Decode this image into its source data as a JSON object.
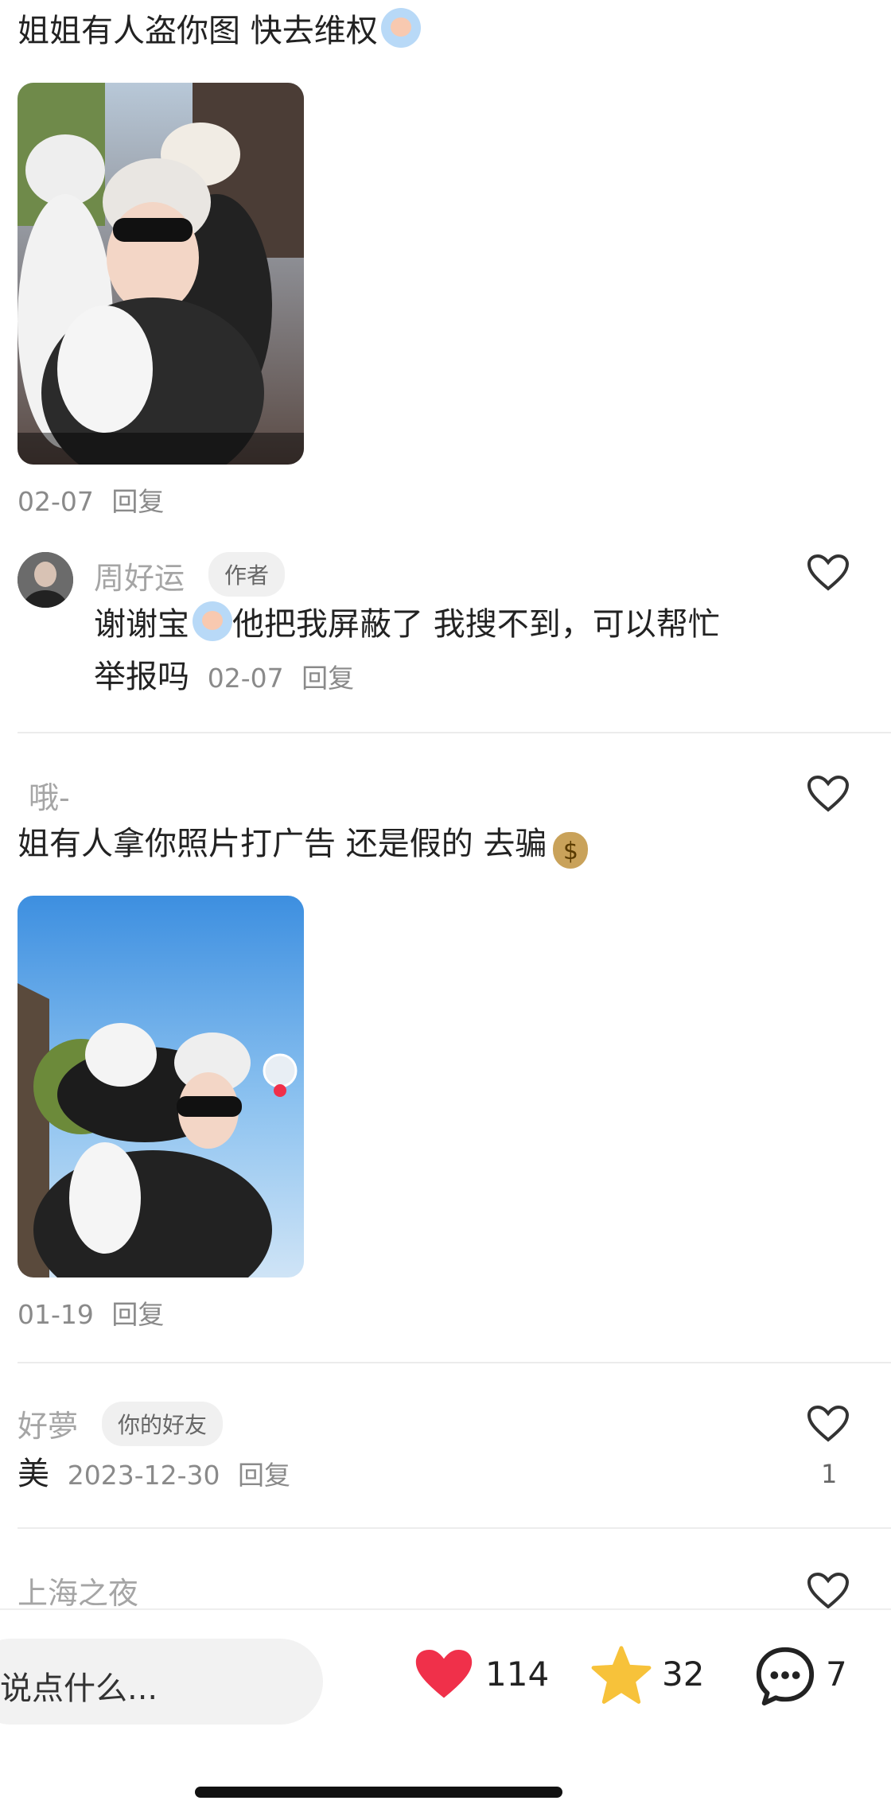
{
  "comments": [
    {
      "text": "姐姐有人盗你图 快去维权",
      "date": "02-07",
      "reply_label": "回复",
      "photo_alt": "截图"
    },
    {
      "name": "周好运",
      "badge": "作者",
      "text_line1": "谢谢宝",
      "text_line1b": "他把我屏蔽了 我搜不到，可以帮忙",
      "text_line2": "举报吗",
      "date": "02-07",
      "reply_label": "回复"
    },
    {
      "name": "哦-",
      "text": "姐有人拿你照片打广告 还是假的 去骗",
      "date": "01-19",
      "reply_label": "回复"
    },
    {
      "name": "好夢",
      "badge": "你的好友",
      "text": "美",
      "date": "2023-12-30",
      "reply_label": "回复",
      "likes": "1"
    },
    {
      "name": "上海之夜"
    }
  ],
  "bottom_bar": {
    "input_placeholder": "说点什么...",
    "likes": "114",
    "favorites": "32",
    "comments": "7"
  },
  "colors": {
    "like_red": "#f0304a",
    "star_yellow": "#f7c23a",
    "meta_gray": "#8a8a8a"
  }
}
